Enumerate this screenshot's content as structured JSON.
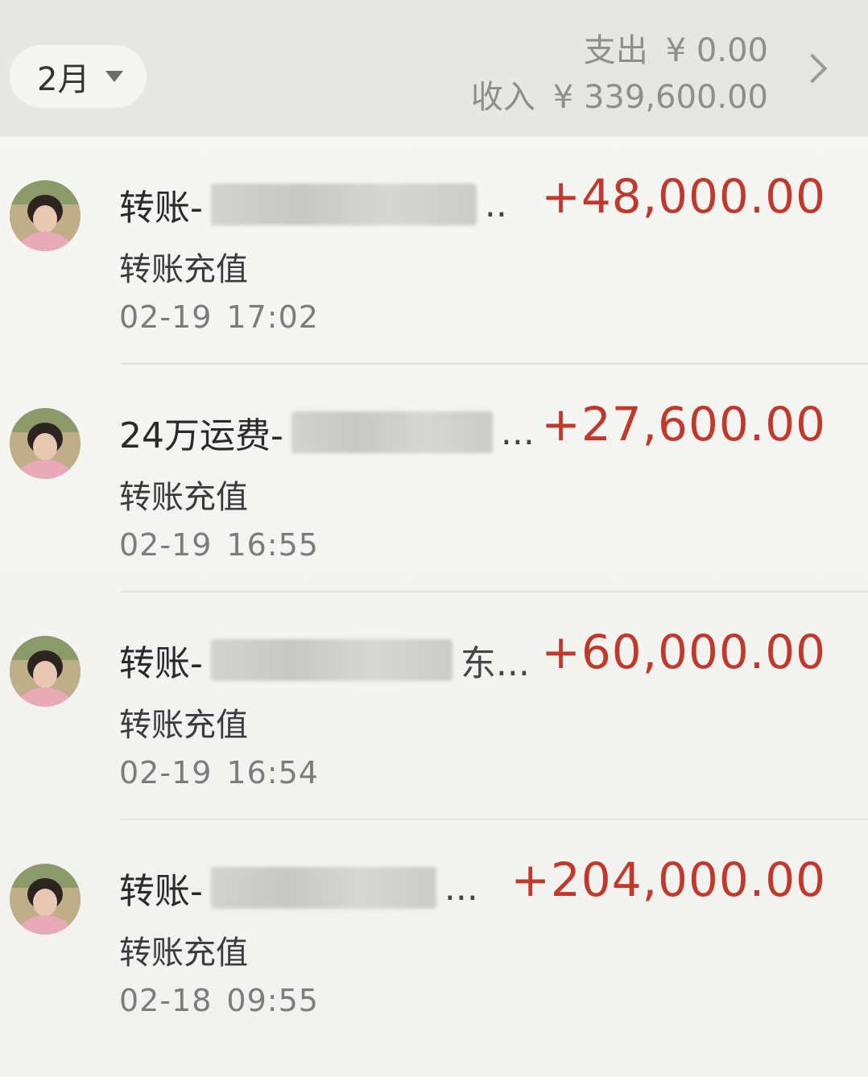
{
  "header": {
    "month": "2月",
    "expense_label": "支出",
    "expense_value": "¥ 0.00",
    "income_label": "收入",
    "income_value": "¥ 339,600.00"
  },
  "transactions": [
    {
      "title": "转账-",
      "tail": "..",
      "amount": "+48,000.00",
      "type": "转账充值",
      "date": "02-19",
      "time": "17:02"
    },
    {
      "title": "24万运费-",
      "tail": "...",
      "amount": "+27,600.00",
      "type": "转账充值",
      "date": "02-19",
      "time": "16:55"
    },
    {
      "title": "转账-",
      "tail": "东...",
      "amount": "+60,000.00",
      "type": "转账充值",
      "date": "02-19",
      "time": "16:54"
    },
    {
      "title": "转账-",
      "tail": "...",
      "amount": "+204,000.00",
      "type": "转账充值",
      "date": "02-18",
      "time": "09:55"
    }
  ]
}
